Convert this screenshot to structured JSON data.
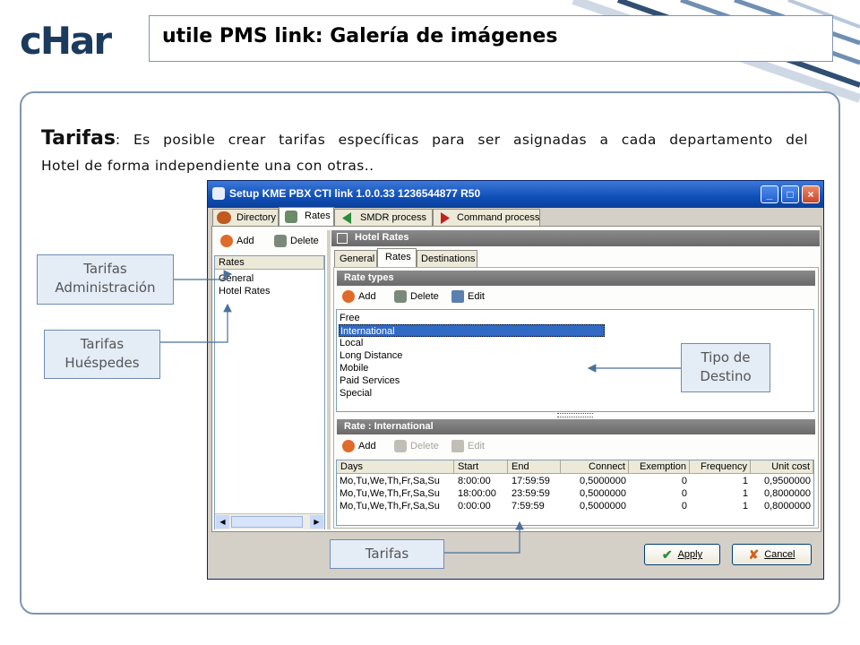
{
  "slide": {
    "logo_text": "cHar",
    "title": "utile PMS link: Galería de imágenes",
    "intro_heading": "Tarifas",
    "intro_line1": ": Es posible crear tarifas específicas para ser asignadas a cada departamento del",
    "intro_line2": "Hotel de forma independiente una con otras..",
    "accent_color": "#1a4f8c",
    "callout_bg": "#e4ecf6"
  },
  "callouts": {
    "admin_line1": "Tarifas",
    "admin_line2": "Administración",
    "guests_line1": "Tarifas",
    "guests_line2": "Huéspedes",
    "dest_line1": "Tipo de",
    "dest_line2": "Destino",
    "rates": "Tarifas"
  },
  "window": {
    "title": "Setup KME PBX CTI link 1.0.0.33  1236544877 R50",
    "tabs": [
      "Directory",
      "Rates",
      "SMDR process",
      "Command process"
    ],
    "left_toolbar": {
      "add": "Add",
      "delete": "Delete"
    },
    "left_list": {
      "header": "Rates",
      "items": [
        "General",
        "Hotel Rates"
      ]
    },
    "right_title": "Hotel Rates",
    "inner_tabs": [
      "General",
      "Rates",
      "Destinations"
    ],
    "rate_types_title": "Rate types",
    "rate_types_toolbar": {
      "add": "Add",
      "delete": "Delete",
      "edit": "Edit"
    },
    "rate_types": [
      "Free",
      "International",
      "Local",
      "Long Distance",
      "Mobile",
      "Paid Services",
      "Special"
    ],
    "rate_types_selected": "International",
    "rate_detail_title": "Rate : International",
    "rate_detail_toolbar": {
      "add": "Add",
      "delete": "Delete",
      "edit": "Edit"
    },
    "columns": [
      "Days",
      "Start",
      "End",
      "Connect",
      "Exemption",
      "Frequency",
      "Unit cost"
    ],
    "rows": [
      [
        "Mo,Tu,We,Th,Fr,Sa,Su",
        "8:00:00",
        "17:59:59",
        "0,5000000",
        "0",
        "1",
        "0,9500000"
      ],
      [
        "Mo,Tu,We,Th,Fr,Sa,Su",
        "18:00:00",
        "23:59:59",
        "0,5000000",
        "0",
        "1",
        "0,8000000"
      ],
      [
        "Mo,Tu,We,Th,Fr,Sa,Su",
        "0:00:00",
        "7:59:59",
        "0,5000000",
        "0",
        "1",
        "0,8000000"
      ]
    ],
    "apply": "Apply",
    "cancel": "Cancel",
    "min_icon": "minimize-icon",
    "max_icon": "maximize-icon",
    "close_icon": "close-icon"
  }
}
